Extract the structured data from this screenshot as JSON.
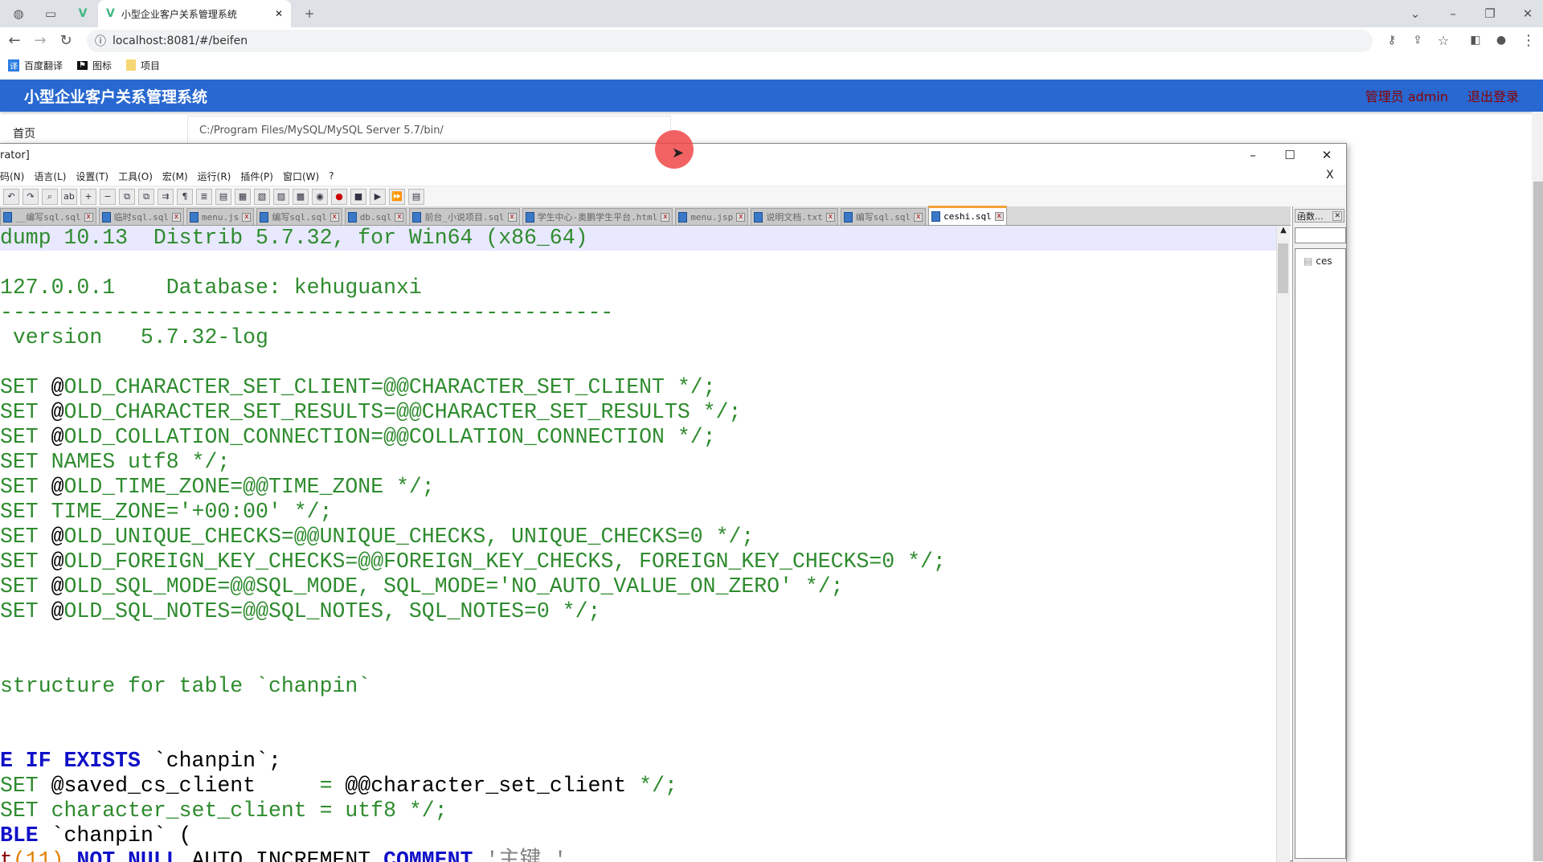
{
  "browser": {
    "tab_title": "小型企业客户关系管理系统",
    "url": "localhost:8081/#/beifen",
    "bookmarks": [
      "百度翻译",
      "图标",
      "项目"
    ]
  },
  "app": {
    "title": "小型企业客户关系管理系统",
    "user": "管理员 admin",
    "logout": "退出登录",
    "sidebar_home": "首页",
    "path_value": "C:/Program Files/MySQL/MySQL Server 5.7/bin/"
  },
  "npp": {
    "title": "rator]",
    "close_doc": "X",
    "menu": [
      "码(N)",
      "语言(L)",
      "设置(T)",
      "工具(O)",
      "宏(M)",
      "运行(R)",
      "插件(P)",
      "窗口(W)",
      "?"
    ],
    "tabs": [
      {
        "label": "__编写sql.sql"
      },
      {
        "label": "临时sql.sql"
      },
      {
        "label": "menu.js"
      },
      {
        "label": "编写sql.sql"
      },
      {
        "label": "db.sql"
      },
      {
        "label": "前台_小说项目.sql"
      },
      {
        "label": "学生中心-奥鹏学生平台.html"
      },
      {
        "label": "menu.jsp"
      },
      {
        "label": "说明文档.txt"
      },
      {
        "label": "编写sql.sql"
      },
      {
        "label": "ceshi.sql",
        "active": true
      }
    ],
    "function_panel": {
      "title": "函数...",
      "item": "ces"
    },
    "lines": [
      [
        [
          "g",
          "dump 10.13  Distrib 5.7.32, for Win64 (x86_64)"
        ]
      ],
      [],
      [
        [
          "g",
          "127.0.0.1    Database: kehuguanxi"
        ]
      ],
      [
        [
          "g",
          "------------------------------------------------"
        ]
      ],
      [
        [
          "g",
          " version   5.7.32-log"
        ]
      ],
      [],
      [
        [
          "g",
          "SET "
        ],
        [
          "p",
          "@"
        ],
        [
          "g",
          "OLD_CHARACTER_SET_CLIENT=@@CHARACTER_SET_CLIENT */;"
        ]
      ],
      [
        [
          "g",
          "SET "
        ],
        [
          "p",
          "@"
        ],
        [
          "g",
          "OLD_CHARACTER_SET_RESULTS=@@CHARACTER_SET_RESULTS */;"
        ]
      ],
      [
        [
          "g",
          "SET "
        ],
        [
          "p",
          "@"
        ],
        [
          "g",
          "OLD_COLLATION_CONNECTION=@@COLLATION_CONNECTION */;"
        ]
      ],
      [
        [
          "g",
          "SET NAMES utf8 */;"
        ]
      ],
      [
        [
          "g",
          "SET "
        ],
        [
          "p",
          "@"
        ],
        [
          "g",
          "OLD_TIME_ZONE=@@TIME_ZONE */;"
        ]
      ],
      [
        [
          "g",
          "SET TIME_ZONE='+00:00' */;"
        ]
      ],
      [
        [
          "g",
          "SET "
        ],
        [
          "p",
          "@"
        ],
        [
          "g",
          "OLD_UNIQUE_CHECKS=@@UNIQUE_CHECKS, UNIQUE_CHECKS=0 */;"
        ]
      ],
      [
        [
          "g",
          "SET "
        ],
        [
          "p",
          "@"
        ],
        [
          "g",
          "OLD_FOREIGN_KEY_CHECKS=@@FOREIGN_KEY_CHECKS, FOREIGN_KEY_CHECKS=0 */;"
        ]
      ],
      [
        [
          "g",
          "SET "
        ],
        [
          "p",
          "@"
        ],
        [
          "g",
          "OLD_SQL_MODE=@@SQL_MODE, SQL_MODE='NO_AUTO_VALUE_ON_ZERO' */;"
        ]
      ],
      [
        [
          "g",
          "SET "
        ],
        [
          "p",
          "@"
        ],
        [
          "g",
          "OLD_SQL_NOTES=@@SQL_NOTES, SQL_NOTES=0 */;"
        ]
      ],
      [],
      [],
      [
        [
          "g",
          "structure for table `chanpin`"
        ]
      ],
      [],
      [],
      [
        [
          "k",
          "E IF EXISTS "
        ],
        [
          "p",
          "`chanpin`;"
        ]
      ],
      [
        [
          "g",
          "SET "
        ],
        [
          "p",
          "@saved_cs_client     "
        ],
        [
          "g",
          "= "
        ],
        [
          "p",
          "@@character_set_client "
        ],
        [
          "g",
          "*/;"
        ]
      ],
      [
        [
          "g",
          "SET character_set_client = utf8 */;"
        ]
      ],
      [
        [
          "k",
          "BLE "
        ],
        [
          "p",
          "`chanpin` ("
        ]
      ],
      [
        [
          "r",
          "t"
        ],
        [
          "n",
          "(11) "
        ],
        [
          "k",
          "NOT NULL "
        ],
        [
          "p",
          "AUTO_INCREMENT "
        ],
        [
          "k",
          "COMMENT "
        ],
        [
          "s",
          "'主键 ',"
        ]
      ]
    ]
  },
  "colors": {
    "header": "#2868d0",
    "comment": "#2e8b2e",
    "keyword": "#1010c8"
  }
}
